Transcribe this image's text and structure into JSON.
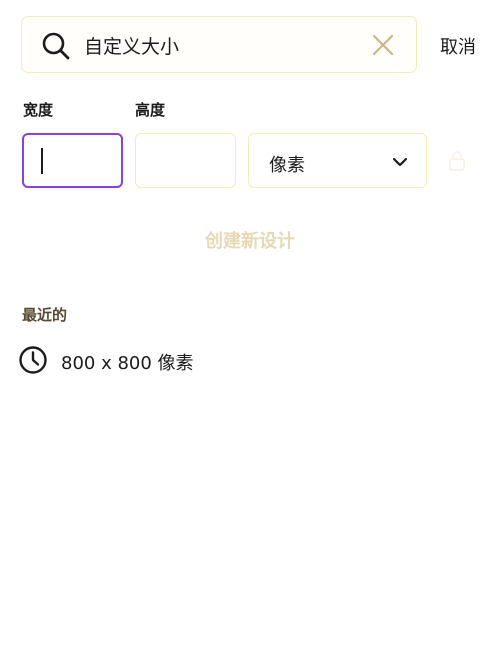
{
  "search": {
    "value": "自定义大小",
    "cancel_label": "取消",
    "search_icon": "search-icon",
    "clear_icon": "close-icon"
  },
  "size_form": {
    "width_label": "宽度",
    "height_label": "高度",
    "width_value": "",
    "height_value": "",
    "unit_selected": "像素",
    "unit_icon": "chevron-down-icon",
    "create_label": "创建新设计",
    "colors": {
      "focus_border": "#8c3fdf",
      "field_border": "#f7ebb8",
      "disabled_text": "#e6d9b3"
    }
  },
  "recent": {
    "title": "最近的",
    "items": [
      {
        "icon": "clock-icon",
        "label": "800 x 800 像素"
      }
    ]
  }
}
